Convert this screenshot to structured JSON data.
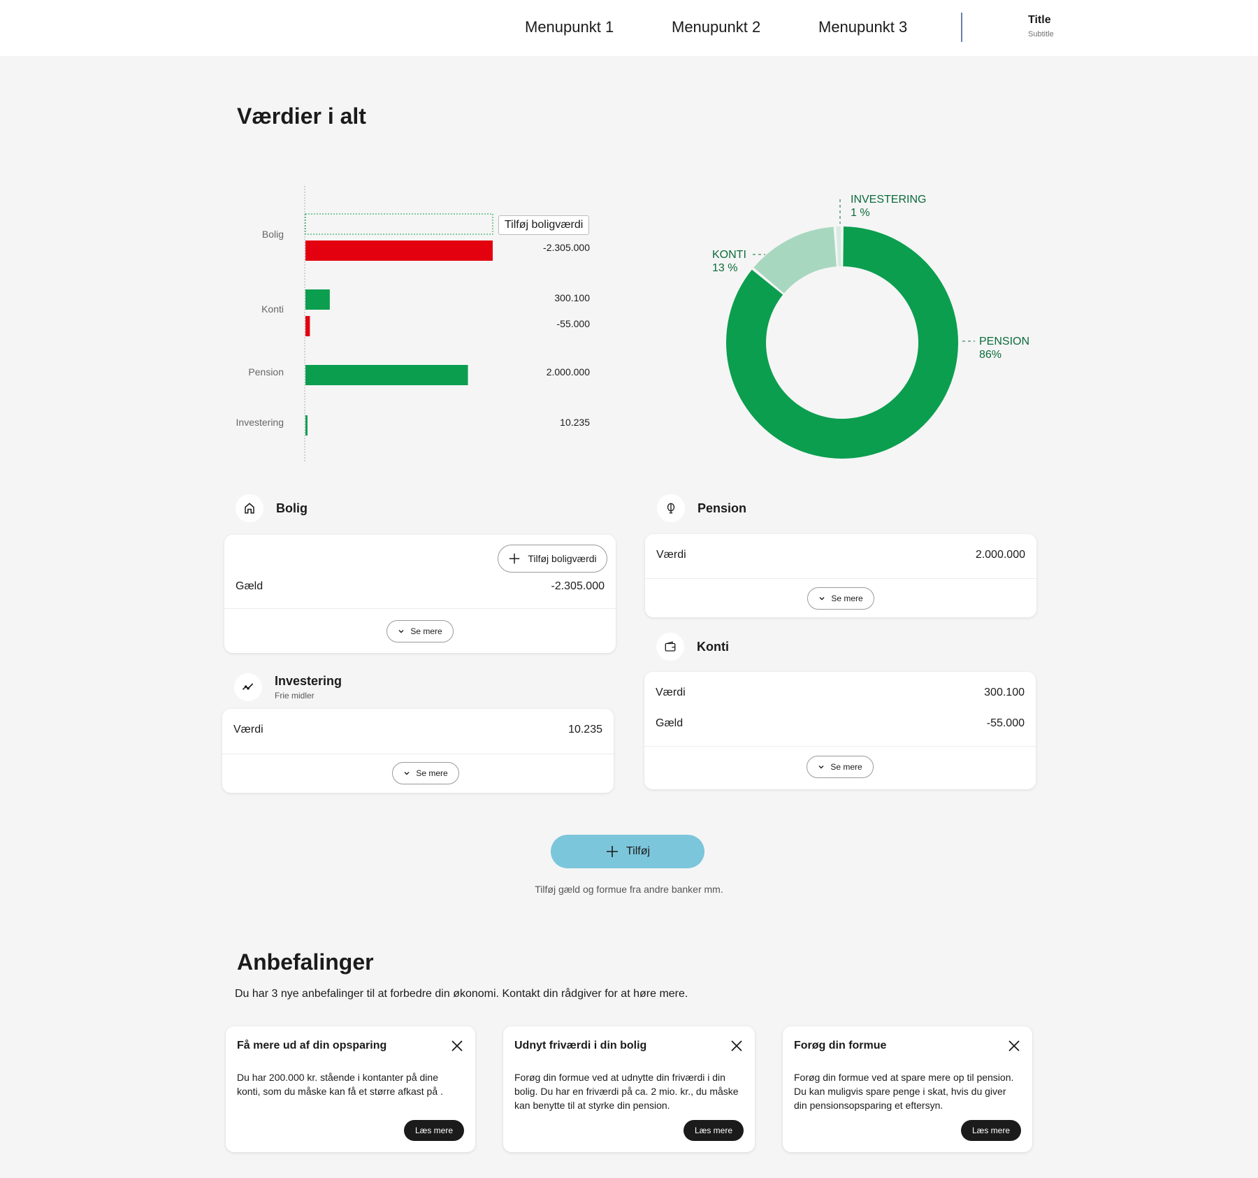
{
  "nav": {
    "items": [
      "Menupunkt 1",
      "Menupunkt 2",
      "Menupunkt 3"
    ],
    "title": "Title",
    "subtitle": "Subtitle"
  },
  "values_section": {
    "heading": "Værdier i alt"
  },
  "chart_data": [
    {
      "type": "bar",
      "orientation": "horizontal",
      "categories": [
        "Bolig",
        "Konti",
        "Pension",
        "Investering"
      ],
      "bars": [
        {
          "category": "Bolig",
          "value": -2305000,
          "label": "-2.305.000",
          "color": "#e3000f"
        },
        {
          "category": "Konti",
          "value": 300100,
          "label": "300.100",
          "color": "#0b9e4f"
        },
        {
          "category": "Konti",
          "value": -55000,
          "label": "-55.000",
          "color": "#e3000f"
        },
        {
          "category": "Pension",
          "value": 2000000,
          "label": "2.000.000",
          "color": "#0b9e4f"
        },
        {
          "category": "Investering",
          "value": 10235,
          "label": "10.235",
          "color": "#0b9e4f"
        }
      ],
      "placeholder_label": "Tilføj boligværdi",
      "xlim": [
        0,
        2305000
      ]
    },
    {
      "type": "pie",
      "style": "donut",
      "slices": [
        {
          "name": "PENSION",
          "value": 86,
          "label": "86%",
          "color": "#0b9e4f"
        },
        {
          "name": "KONTI",
          "value": 13,
          "label": "13 %",
          "color": "#a8d7bf"
        },
        {
          "name": "INVESTERING",
          "value": 1,
          "label": "1 %",
          "color": "#d6ece0"
        }
      ]
    }
  ],
  "bolig": {
    "title": "Bolig",
    "add_button": "Tilføj boligværdi",
    "rows": [
      {
        "label": "Gæld",
        "value": "-2.305.000"
      }
    ],
    "more": "Se mere"
  },
  "pension": {
    "title": "Pension",
    "rows": [
      {
        "label": "Værdi",
        "value": "2.000.000"
      }
    ],
    "more": "Se mere"
  },
  "investering": {
    "title": "Investering",
    "subtitle": "Frie midler",
    "rows": [
      {
        "label": "Værdi",
        "value": "10.235"
      }
    ],
    "more": "Se mere"
  },
  "konti": {
    "title": "Konti",
    "rows": [
      {
        "label": "Værdi",
        "value": "300.100"
      },
      {
        "label": "Gæld",
        "value": "-55.000"
      }
    ],
    "more": "Se mere"
  },
  "add": {
    "label": "Tilføj",
    "hint": "Tilføj gæld og formue fra andre banker mm.",
    "color": "#7cc6db"
  },
  "recommendations": {
    "heading": "Anbefalinger",
    "intro": "Du har 3 nye anbefalinger til at forbedre din økonomi. Kontakt din rådgiver for at høre mere.",
    "cards": [
      {
        "title": "Få mere ud af din opsparing",
        "body": "Du har 200.000 kr. stående i kontanter på dine konti, som du måske kan få et større afkast på .",
        "button": "Læs mere"
      },
      {
        "title": "Udnyt friværdi i din bolig",
        "body": "Forøg din formue ved at udnytte din friværdi i din bolig. Du har en friværdi på ca. 2 mio. kr., du måske kan benytte til at styrke din pension.",
        "button": "Læs mere"
      },
      {
        "title": "Forøg din formue",
        "body": "Forøg din formue ved at spare mere op til pension. Du kan muligvis spare penge i skat, hvis du giver din pensionsopsparing et eftersyn.",
        "button": "Læs mere"
      }
    ]
  }
}
